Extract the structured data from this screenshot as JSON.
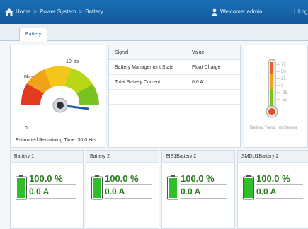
{
  "header": {
    "breadcrumb": [
      "Home",
      "Power System",
      "Battery"
    ],
    "breadcrumb_sep": ">",
    "welcome": "Welcome: admin",
    "logout_sep": "|",
    "logout_label": "Log"
  },
  "tabs": [
    {
      "label": "Battery",
      "active": true
    }
  ],
  "gauge": {
    "top_label": "10Hrs",
    "left_label": "6hrs",
    "zero_label": "0",
    "caption": "Estimated Remaining Time: 30.0 Hrs",
    "colors": [
      "#e23b1f",
      "#f0a21a",
      "#b9d617",
      "#7ac21f"
    ]
  },
  "signal_table": {
    "col_signal": "Signal",
    "col_value": "Value",
    "rows": [
      {
        "signal": "Battery Management State",
        "value": "Float Charge"
      },
      {
        "signal": "Total Battery Current",
        "value": "0.0 A"
      }
    ]
  },
  "temperature": {
    "ticks": [
      "75",
      "50",
      "25",
      "0",
      "-25",
      "-50"
    ],
    "caption": "Battery Temp: No Sensor"
  },
  "batteries": [
    {
      "name": "Battery 1",
      "percent": "100.0 %",
      "current": "0.0 A",
      "level": 1.0
    },
    {
      "name": "Battery 2",
      "percent": "100.0 %",
      "current": "0.0 A",
      "level": 1.0
    },
    {
      "name": "EIB1Battery 2",
      "percent": "100.0 %",
      "current": "0.0 A",
      "level": 1.0
    },
    {
      "name": "SMDU1Battery 2",
      "percent": "100.0 %",
      "current": "0.0 A",
      "level": 1.0
    }
  ],
  "colors": {
    "accent": "#1565a8",
    "battery_green": "#2fbf2a",
    "value_text": "#2b7a1f"
  }
}
